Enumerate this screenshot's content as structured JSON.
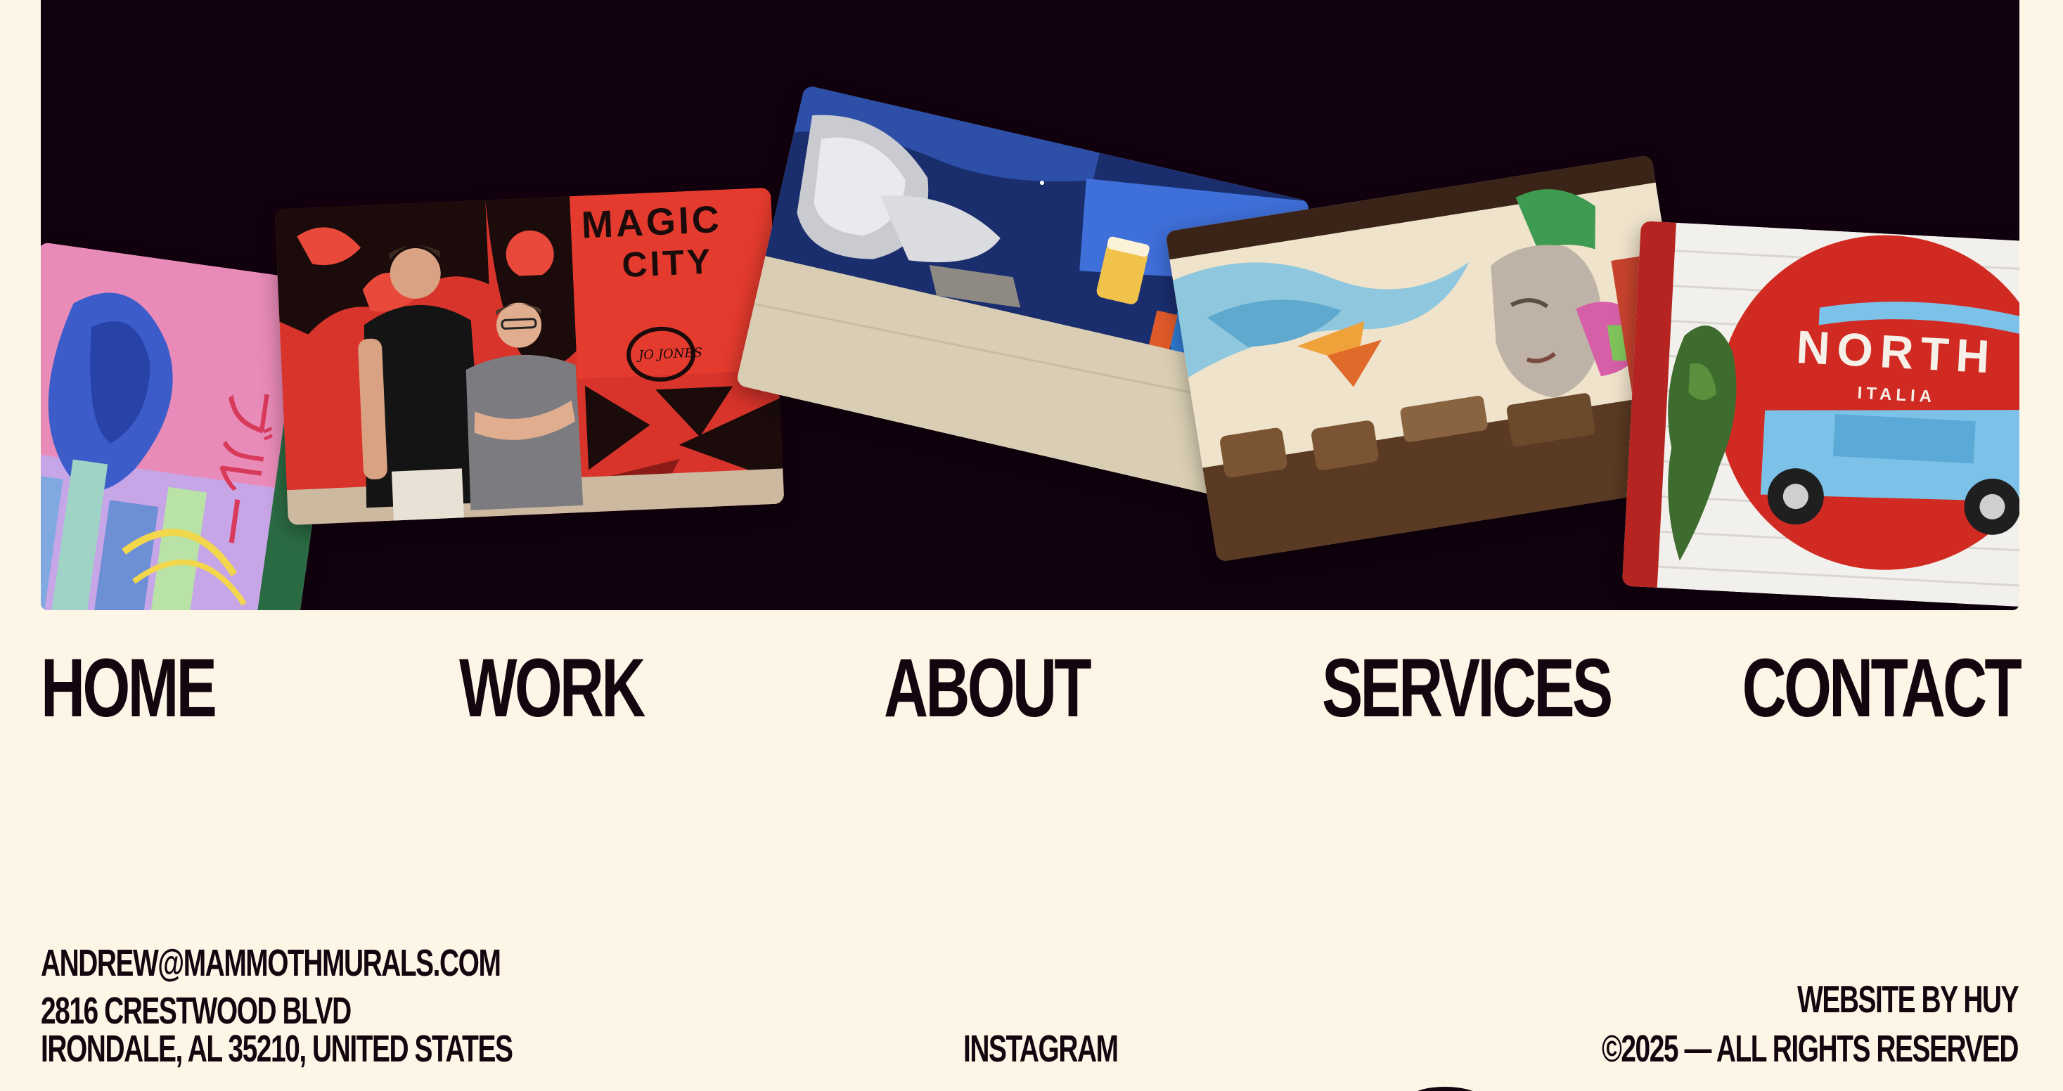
{
  "gallery": {
    "images": [
      {
        "name": "godzilla-city-mural-photo"
      },
      {
        "name": "magic-city-mural-artists-photo"
      },
      {
        "name": "astronaut-space-mural-photo"
      },
      {
        "name": "woman-portrait-mural-photo"
      },
      {
        "name": "north-italia-mural-photo"
      }
    ]
  },
  "nav": {
    "home": "HOME",
    "work": "WORK",
    "about": "ABOUT",
    "services": "SERVICES",
    "contact": "CONTACT"
  },
  "footer": {
    "email": "ANDREW@MAMMOTHMURALS.COM",
    "address_line1": "2816 CRESTWOOD BLVD",
    "address_line2": "IRONDALE, AL 35210, UNITED STATES",
    "instagram": "INSTAGRAM",
    "credit": "WEBSITE BY HUY",
    "rights": "©2025 — ALL RIGHTS RESERVED"
  },
  "mural_text": {
    "magic": "MAGIC",
    "city": "CITY",
    "jo_jones": "JO JONES",
    "japanese": "ブルー",
    "north": "NORTH",
    "italia": "ITALIA"
  },
  "colors": {
    "background": "#FDF6E7",
    "hero_background": "#12010F",
    "text": "#14050F"
  }
}
